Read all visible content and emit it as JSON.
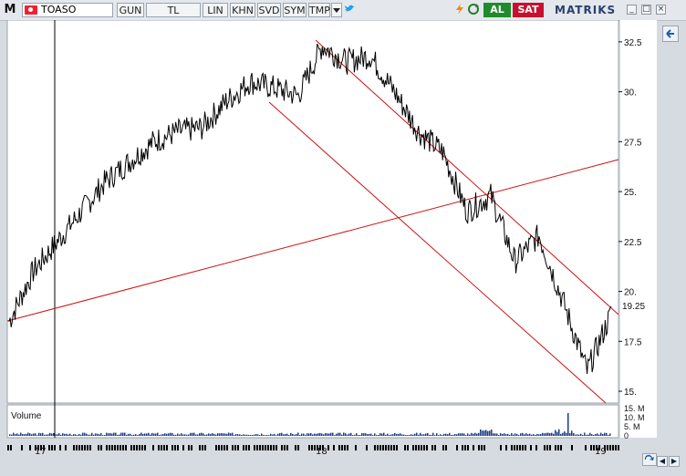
{
  "toolbar": {
    "logo": "M",
    "symbol": "TOASO",
    "period": "GUN",
    "currency": "TL",
    "scale": "LIN",
    "khn": "KHN",
    "svd": "SVD",
    "sym": "SYM",
    "tmp": "TMP",
    "buy_label": "AL",
    "sell_label": "SAT",
    "brand": "MATRIKS",
    "icons": [
      "chevron-down-icon",
      "twitter-icon",
      "lightning-icon",
      "refresh-icon"
    ]
  },
  "window": {
    "min": "_",
    "max": "□",
    "close": "×"
  },
  "chart": {
    "volume_label": "Volume",
    "price_ticks": [
      "32.5",
      "30.",
      "27.5",
      "25.",
      "22.5",
      "20.",
      "17.5",
      "15."
    ],
    "last_price": "19.25",
    "volume_ticks": [
      "15. M",
      "10. M",
      "5. M",
      "0"
    ],
    "date_labels": [
      "17",
      "18",
      "19"
    ],
    "colors": {
      "price": "#000000",
      "trendline": "#cc1111",
      "volume": "#1b3d82",
      "background": "#ffffff"
    }
  },
  "chart_data": {
    "type": "line",
    "title": "",
    "xlabel": "",
    "ylabel": "",
    "ylim": [
      14.5,
      33.5
    ],
    "x": [
      "2016-12",
      "2017-01",
      "2017-02",
      "2017-03",
      "2017-04",
      "2017-05",
      "2017-06",
      "2017-07",
      "2017-08",
      "2017-09",
      "2017-10",
      "2017-11",
      "2017-12",
      "2018-01",
      "2018-02",
      "2018-03",
      "2018-04",
      "2018-05",
      "2018-06",
      "2018-07",
      "2018-08",
      "2018-09",
      "2018-10",
      "2018-11",
      "2018-12",
      "2019-01"
    ],
    "series": [
      {
        "values": [
          18.5,
          21.0,
          22.5,
          24.0,
          25.5,
          26.5,
          27.5,
          28.0,
          28.2,
          29.5,
          30.5,
          30.2,
          29.8,
          32.3,
          31.5,
          31.8,
          30.0,
          28.0,
          27.0,
          24.0,
          24.8,
          21.5,
          22.8,
          19.5,
          16.0,
          18.9
        ]
      }
    ],
    "last_value": 19.25,
    "volume": {
      "y_ticks_label": [
        "15. M",
        "10. M",
        "5. M",
        "0"
      ],
      "peak": 12.5
    }
  }
}
